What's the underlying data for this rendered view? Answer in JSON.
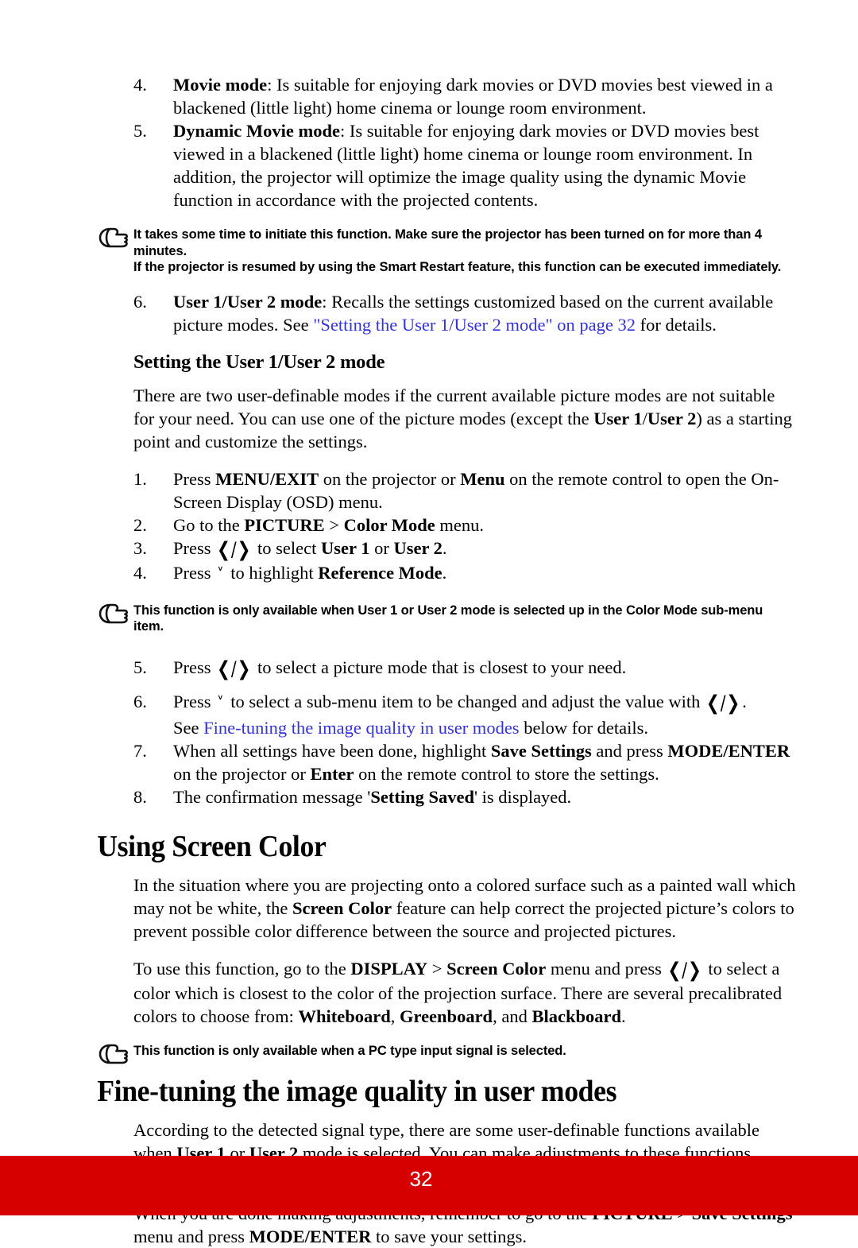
{
  "document": {
    "page_number": "32",
    "footer_color": "#d60000",
    "link_color": "#3333dd",
    "note_icon": "pointing-hand-icon"
  },
  "keys": {
    "left_right": "❮/❯",
    "down": "˅"
  },
  "list_top": [
    {
      "num": "4.",
      "bold_lead": "Movie mode",
      "text": ": Is suitable for enjoying dark movies or DVD movies best viewed in a blackened (little light) home cinema or lounge room environment."
    },
    {
      "num": "5.",
      "bold_lead": "Dynamic Movie mode",
      "text": ": Is suitable for enjoying dark movies or DVD movies best viewed in a blackened (little light) home cinema or lounge room environment. In addition, the projector will optimize the image quality using the dynamic Movie function in accordance with the projected contents."
    }
  ],
  "note_1": {
    "line1": "It takes some time to initiate this function. Make sure the projector has been turned on for more than 4 minutes.",
    "line2": "If the projector is resumed by using the Smart Restart feature, this function can be executed immediately."
  },
  "item_6": {
    "num": "6.",
    "bold_lead": "User 1/User 2 mode",
    "text_before": ": Recalls the settings customized based on the current available picture modes. See ",
    "link": "\"Setting the User 1/User 2 mode\" on page 32",
    "text_after": " for details."
  },
  "heading_setting_user": "Setting the User 1/User 2 mode",
  "para_user_modes": {
    "p1": "There are two user-definable modes if the current available picture modes are not suitable for your need. You can use one of the picture modes (except the ",
    "p1_bold_a": "User 1",
    "p1_mid": "/",
    "p1_bold_b": "User 2",
    "p1_end": ") as a starting point and customize the settings."
  },
  "steps": {
    "s1": {
      "num": "1.",
      "a": "Press ",
      "b1": "MENU/EXIT",
      "b": " on the projector or ",
      "b2": "Menu",
      "c": " on the remote control to open the On-Screen Display (OSD) menu."
    },
    "s2": {
      "num": "2.",
      "a": "Go to the ",
      "b1": "PICTURE",
      "b": " > ",
      "b2": "Color Mode",
      "c": " menu."
    },
    "s3": {
      "num": "3.",
      "a": "Press ",
      "b": " to select ",
      "b1": "User 1",
      "c": " or ",
      "b2": "User 2",
      "d": "."
    },
    "s4": {
      "num": "4.",
      "a": "Press ",
      "b": " to highlight ",
      "b1": "Reference Mode",
      "c": "."
    },
    "s5": {
      "num": "5.",
      "a": "Press ",
      "b": " to select a picture mode that is closest to your need."
    },
    "s6": {
      "num": "6.",
      "a": "Press ",
      "b": " to select a sub-menu item to be changed and adjust the value with ",
      "c": ".",
      "see_before": "See ",
      "link": "Fine-tuning the image quality in user modes",
      "see_after": " below for details."
    },
    "s7": {
      "num": "7.",
      "a": "When all settings have been done, highlight ",
      "b1": "Save Settings",
      "b": " and press ",
      "b2": "MODE/ENTER",
      "c": " on the projector or ",
      "b3": "Enter",
      "d": " on the remote control to store the settings."
    },
    "s8": {
      "num": "8.",
      "a": "The confirmation message '",
      "b1": "Setting Saved",
      "b": "' is displayed."
    }
  },
  "note_2": {
    "line1": "This function is only available when User 1 or User 2 mode is selected up in the Color Mode sub-menu item."
  },
  "heading_using_screen_color": "Using Screen Color",
  "screen_color": {
    "p1_a": "In the situation where you are projecting onto a colored surface such as a painted wall which may not be white, the ",
    "p1_b": "Screen Color",
    "p1_c": " feature can help correct the projected picture’s colors to prevent possible color difference between the source and projected pictures.",
    "p2_a": "To use this function, go to the ",
    "p2_b1": "DISPLAY",
    "p2_mid": " > ",
    "p2_b2": "Screen Color",
    "p2_c": " menu and press ",
    "p2_d": " to select a color which is closest to the color of the projection surface. There are several precalibrated colors to choose from: ",
    "p2_b3": "Whiteboard",
    "p2_sep1": ", ",
    "p2_b4": "Greenboard",
    "p2_sep2": ", and ",
    "p2_b5": "Blackboard",
    "p2_end": "."
  },
  "note_3": {
    "line1": "This function is only available when a PC type input signal is selected."
  },
  "heading_fine_tuning": "Fine-tuning the image quality in user modes",
  "fine_tuning": {
    "p1_a": "According to the detected signal type, there are some user-definable functions available when ",
    "p1_b1": "User 1",
    "p1_mid": " or ",
    "p1_b2": "User 2",
    "p1_c": " mode is selected. You can make adjustments to these functions based on your needs.",
    "p2_a": "When you are done making adjustments, remember to go to the ",
    "p2_b1": "PICTURE",
    "p2_mid": " > ",
    "p2_b2": "Save Settings",
    "p2_c": " menu and press ",
    "p2_b3": "MODE/ENTER",
    "p2_d": " to save your settings."
  }
}
